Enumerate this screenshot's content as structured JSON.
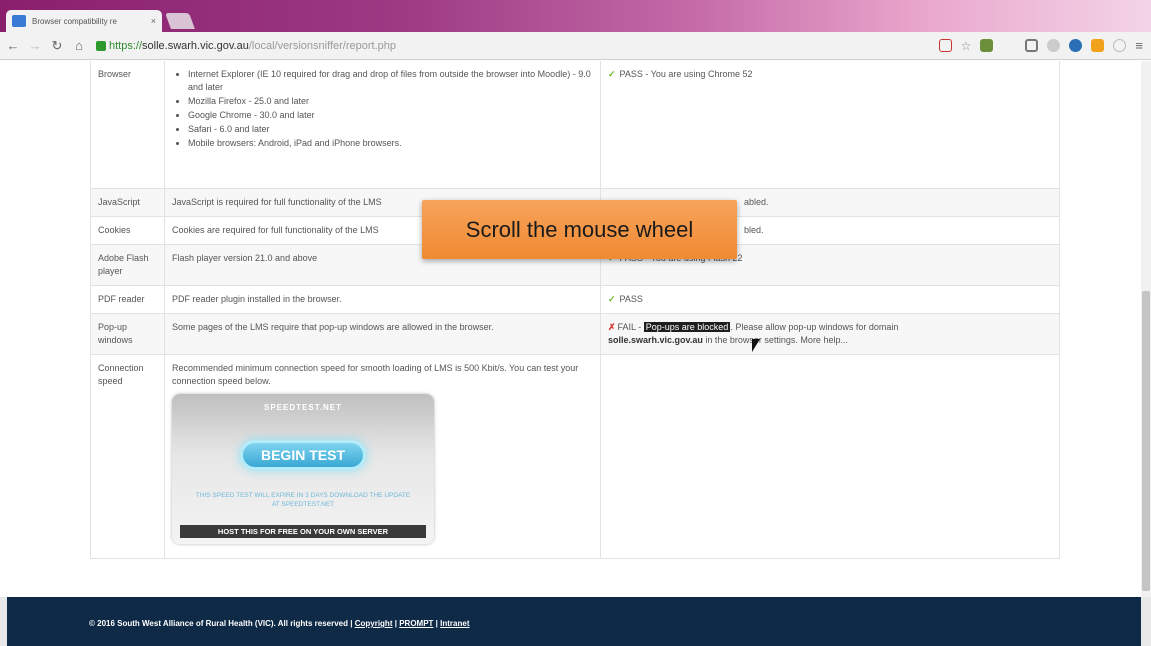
{
  "browser": {
    "tab_title": "Browser compatibility re",
    "tab_close": "×",
    "url_scheme": "https://",
    "url_host": "solle.swarh.vic.gov.au",
    "url_path": "/local/versionsniffer/report.php"
  },
  "rows": [
    {
      "name": "Browser",
      "requirements": [
        "Internet Explorer (IE 10 required for drag and drop of files from outside the browser into Moodle) - 9.0 and later",
        "Mozilla Firefox - 25.0 and later",
        "Google Chrome - 30.0 and later",
        "Safari - 6.0 and later",
        "Mobile browsers: Android, iPad and iPhone browsers."
      ],
      "status_mark": "✓",
      "status": "PASS - You are using Chrome 52"
    },
    {
      "name": "JavaScript",
      "requirement": "JavaScript is required for full functionality of the LMS",
      "status_mark": "✓",
      "status": "abled."
    },
    {
      "name": "Cookies",
      "requirement": "Cookies are required for full functionality of the LMS",
      "status": "bled."
    },
    {
      "name": "Adobe Flash player",
      "requirement": "Flash player version 21.0 and above",
      "status_mark": "✓",
      "status": "PASS - You are using Flash 22"
    },
    {
      "name": "PDF reader",
      "requirement": "PDF reader plugin installed in the browser.",
      "status_mark": "✓",
      "status": "PASS"
    },
    {
      "name": "Pop-up windows",
      "requirement": "Some pages of the LMS require that pop-up windows are allowed in the browser.",
      "status_mark": "✗",
      "status_fail": "FAIL -",
      "status_highlight": "Pop-ups are blocked",
      "status_rest": ". Please allow pop-up windows for domain",
      "status_domain": "solle.swarh.vic.gov.au",
      "status_tail": "in the browser settings. More help..."
    },
    {
      "name": "Connection speed",
      "requirement": "Recommended minimum connection speed for smooth loading of LMS is 500 Kbit/s. You can test your connection speed below."
    }
  ],
  "speedtest": {
    "logo": "SPEEDTEST.NET",
    "button": "BEGIN TEST",
    "note": "THIS SPEED TEST WILL EXPIRE IN 3 DAYS DOWNLOAD THE UPDATE AT SPEEDTEST.NET",
    "host_bar": "HOST THIS FOR FREE ON YOUR OWN SERVER"
  },
  "callout": "Scroll the mouse wheel",
  "footer": {
    "text": "© 2016 South West Alliance of Rural Health (VIC). All rights reserved |",
    "copyright": "Copyright",
    "sep1": "|",
    "prompt": "PROMPT",
    "sep2": "|",
    "intranet": "Intranet"
  },
  "colors": {
    "pass": "#6bb82c",
    "fail": "#d93a3a",
    "footer_bg": "#0e2a47",
    "callout": "#f08a33"
  }
}
